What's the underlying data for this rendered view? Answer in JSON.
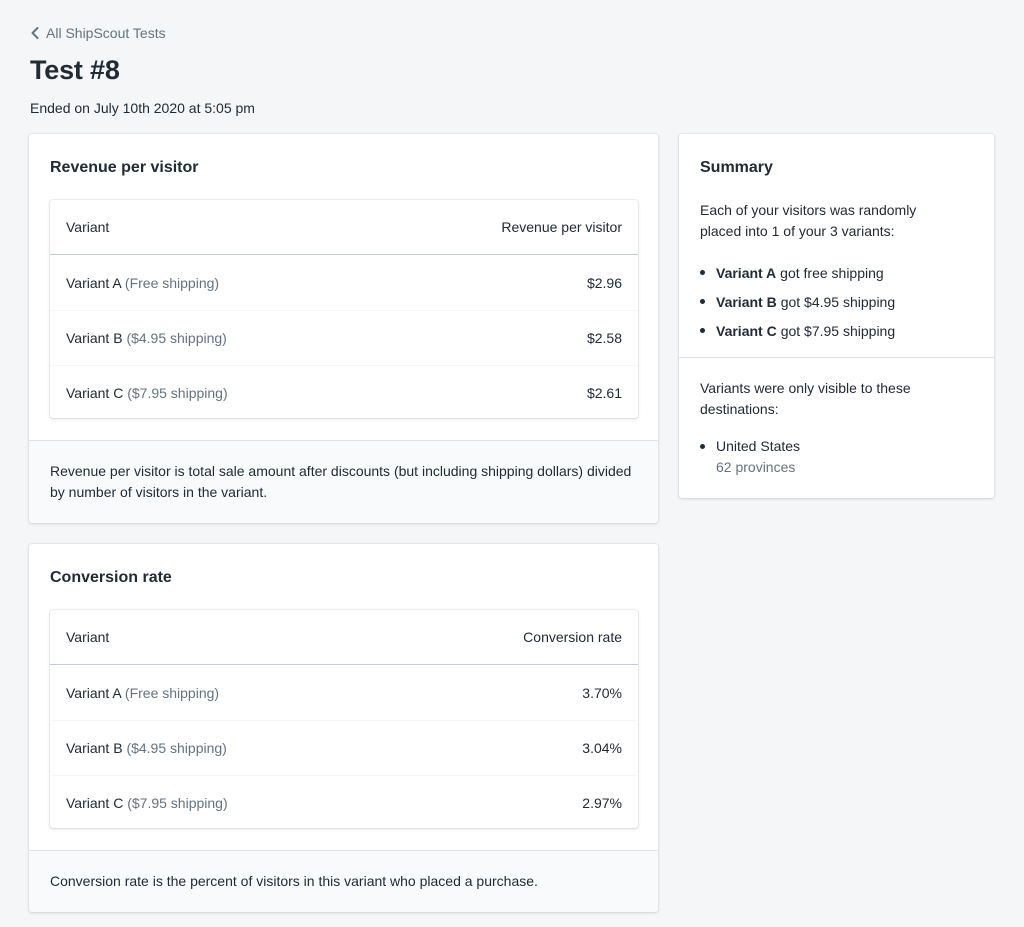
{
  "header": {
    "back_link": "All ShipScout Tests",
    "title": "Test #8",
    "subtitle": "Ended on July 10th 2020 at 5:05 pm",
    "back_icon": "chevron-left-icon"
  },
  "revenue": {
    "title": "Revenue per visitor",
    "columns": [
      "Variant",
      "Revenue per visitor"
    ],
    "rows": [
      {
        "variant": "Variant A",
        "note": "(Free shipping)",
        "value": "$2.96"
      },
      {
        "variant": "Variant B",
        "note": "($4.95 shipping)",
        "value": "$2.58"
      },
      {
        "variant": "Variant C",
        "note": "($7.95 shipping)",
        "value": "$2.61"
      }
    ],
    "footer": "Revenue per visitor is total sale amount after discounts (but including shipping dollars) divided by number of visitors in the variant."
  },
  "conversion": {
    "title": "Conversion rate",
    "columns": [
      "Variant",
      "Conversion rate"
    ],
    "rows": [
      {
        "variant": "Variant A",
        "note": "(Free shipping)",
        "value": "3.70%"
      },
      {
        "variant": "Variant B",
        "note": "($4.95 shipping)",
        "value": "3.04%"
      },
      {
        "variant": "Variant C",
        "note": "($7.95 shipping)",
        "value": "2.97%"
      }
    ],
    "footer": "Conversion rate is the percent of visitors in this variant who placed a purchase."
  },
  "summary": {
    "title": "Summary",
    "description": "Each of your visitors was randomly placed into 1 of your 3 variants:",
    "variants": [
      {
        "name": "Variant A",
        "text": "got free shipping"
      },
      {
        "name": "Variant B",
        "text": "got $4.95 shipping"
      },
      {
        "name": "Variant C",
        "text": "got $7.95 shipping"
      }
    ],
    "destinations_description": "Variants were only visible to these destinations:",
    "destinations": [
      {
        "country": "United States",
        "detail": "62 provinces"
      }
    ]
  }
}
